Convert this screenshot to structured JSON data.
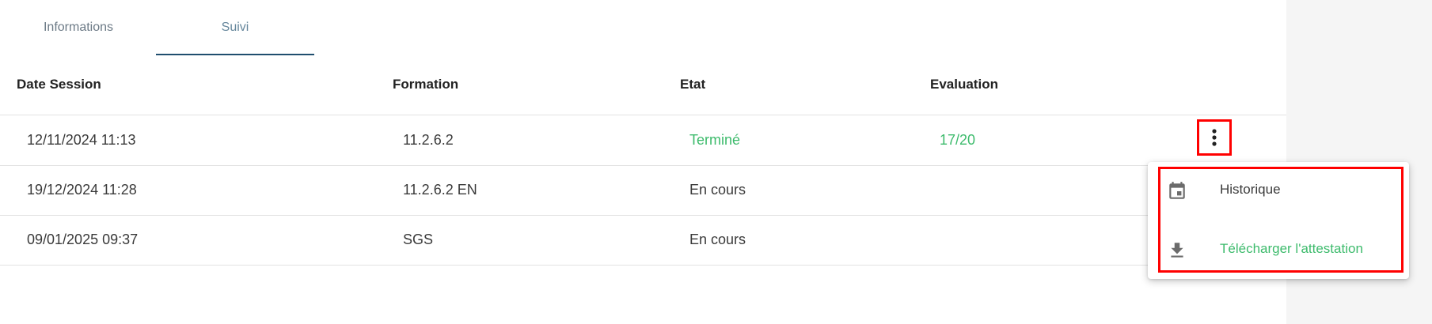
{
  "tabs": [
    {
      "label": "Informations"
    },
    {
      "label": "Suivi",
      "active": true
    }
  ],
  "table": {
    "headers": [
      "Date Session",
      "Formation",
      "Etat",
      "Evaluation"
    ],
    "rows": [
      {
        "date": "12/11/2024 11:13",
        "formation": "11.2.6.2",
        "etat": "Terminé",
        "evaluation": "17/20"
      },
      {
        "date": "19/12/2024 11:28",
        "formation": "11.2.6.2 EN",
        "etat": "En cours",
        "evaluation": ""
      },
      {
        "date": "09/01/2025 09:37",
        "formation": "SGS",
        "etat": "En cours",
        "evaluation": ""
      }
    ]
  },
  "menu": {
    "items": [
      {
        "label": "Historique",
        "icon": "calendar-icon"
      },
      {
        "label": "Télécharger l'attestation",
        "icon": "download-icon"
      }
    ]
  },
  "colors": {
    "accent_green": "#3dbb6c",
    "tab_underline": "#1f4e6e",
    "highlight_red": "#ff0000",
    "side_panel": "#f5f5f5"
  }
}
